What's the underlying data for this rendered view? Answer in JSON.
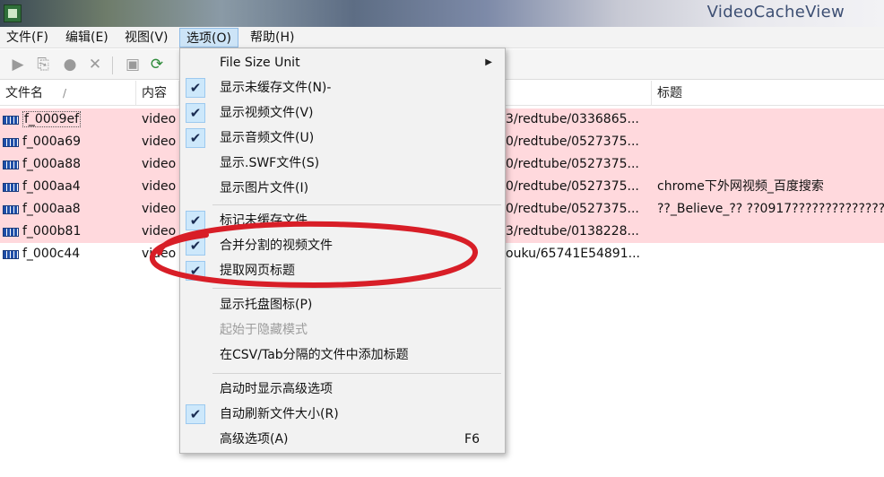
{
  "window": {
    "title": "VideoCacheView"
  },
  "menubar": {
    "items": [
      {
        "label": "文件(F)"
      },
      {
        "label": "编辑(E)"
      },
      {
        "label": "视图(V)"
      },
      {
        "label": "选项(O)"
      },
      {
        "label": "帮助(H)"
      }
    ]
  },
  "toolbar": {
    "icons": [
      "play-icon",
      "copy-icon",
      "record-icon",
      "delete-icon",
      "save-icon",
      "refresh-icon"
    ]
  },
  "list": {
    "headers": {
      "name": "文件名",
      "content": "内容类",
      "title": "标题"
    },
    "rows": [
      {
        "name": "f_0009ef",
        "content": "video",
        "url": "3/redtube/0336865...",
        "title": "",
        "highlight": true,
        "selected": true
      },
      {
        "name": "f_000a69",
        "content": "video",
        "url": "0/redtube/0527375...",
        "title": "",
        "highlight": true
      },
      {
        "name": "f_000a88",
        "content": "video",
        "url": "0/redtube/0527375...",
        "title": "",
        "highlight": true
      },
      {
        "name": "f_000aa4",
        "content": "video",
        "url": "0/redtube/0527375...",
        "title": "chrome下外网视频_百度搜索",
        "highlight": true
      },
      {
        "name": "f_000aa8",
        "content": "video",
        "url": "0/redtube/0527375...",
        "title": "??_Believe_?? ??0917??????????????",
        "highlight": true
      },
      {
        "name": "f_000b81",
        "content": "video",
        "url": "3/redtube/0138228...",
        "title": "",
        "highlight": true
      },
      {
        "name": "f_000c44",
        "content": "video",
        "url": "ouku/65741E54891...",
        "title": "",
        "highlight": false
      }
    ]
  },
  "options_menu": {
    "items": [
      {
        "label": "File Size Unit",
        "checked": false,
        "submenu": true
      },
      {
        "label": "显示未缓存文件(N)-",
        "checked": true
      },
      {
        "label": "显示视频文件(V)",
        "checked": true
      },
      {
        "label": "显示音频文件(U)",
        "checked": true
      },
      {
        "label": "显示.SWF文件(S)",
        "checked": false
      },
      {
        "label": "显示图片文件(I)",
        "checked": false
      },
      {
        "label": "标记未缓存文件",
        "checked": true
      },
      {
        "label": "合并分割的视频文件",
        "checked": true
      },
      {
        "label": "提取网页标题",
        "checked": true
      },
      {
        "label": "显示托盘图标(P)",
        "checked": false
      },
      {
        "label": "起始于隐藏模式",
        "checked": false,
        "disabled": true
      },
      {
        "label": "在CSV/Tab分隔的文件中添加标题",
        "checked": false
      },
      {
        "label": "启动时显示高级选项",
        "checked": false
      },
      {
        "label": "自动刷新文件大小(R)",
        "checked": true
      },
      {
        "label": "高级选项(A)",
        "checked": false,
        "shortcut": "F6"
      }
    ]
  },
  "colors": {
    "highlight_row": "#ffd9dd",
    "check_bg": "#cde8fb",
    "annotation": "#d81e27"
  }
}
